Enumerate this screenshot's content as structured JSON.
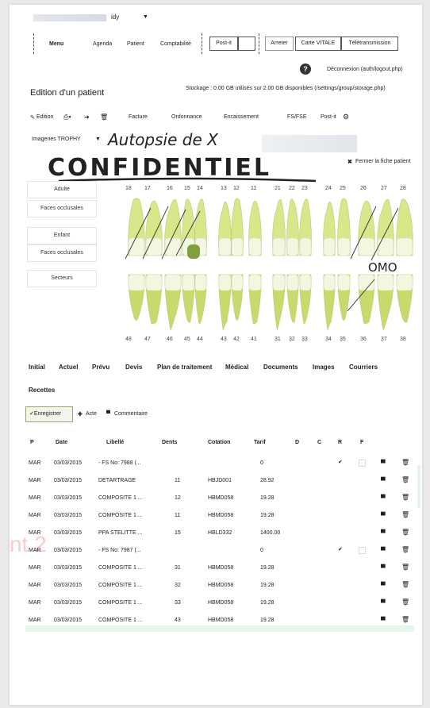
{
  "topbar": {
    "user_fragment": "idy",
    "caret": "▼"
  },
  "menu": {
    "items": [
      "Menu",
      "Agenda",
      "Patient",
      "Comptabilité"
    ],
    "postit_btn": "Post-it",
    "arreter_btn": "Arreter",
    "carte_vitale_btn": "Carte VITALE",
    "teletrans_btn": "Télétransmission"
  },
  "header": {
    "help_icon": "?",
    "logout": "Déconnexion (auth/logout.php)",
    "page_title": "Edition d'un patient",
    "storage": "Stockage : 0.00 GB utilisés sur 2.00 GB disponibles (/settings/group/storage.php)"
  },
  "toolbar": {
    "edition": "Edition",
    "facture": "Facture",
    "ordonnance": "Ordonnance",
    "encaissement": "Encaissement",
    "fsfse": "FS/FSE",
    "postit": "Post-it"
  },
  "imageries": {
    "select": "Imageries TROPHY",
    "caret": "▼"
  },
  "handwriting": {
    "line1": "Autopsie de X",
    "line2": "CONFIDENTIEL",
    "note": "OMO"
  },
  "fermer": "Fermer la fiche patient",
  "side": {
    "adulte": "Adulte",
    "faces1": "Faces occlusales",
    "enfant": "Enfant",
    "faces2": "Faces occlusales",
    "secteurs": "Secteurs"
  },
  "teeth": {
    "upper": [
      "18",
      "17",
      "16",
      "15",
      "14",
      "13",
      "12",
      "11",
      "21",
      "22",
      "23",
      "24",
      "25",
      "26",
      "27",
      "28"
    ],
    "lower": [
      "48",
      "47",
      "46",
      "45",
      "44",
      "43",
      "42",
      "41",
      "31",
      "32",
      "33",
      "34",
      "35",
      "36",
      "37",
      "38"
    ],
    "colors": {
      "tooth": "#d7e88b",
      "root": "#c7db6d",
      "crown": "#f2f7df",
      "filled": "#7ea13e"
    }
  },
  "tabs": [
    "Initial",
    "Actuel",
    "Prévu",
    "Devis",
    "Plan de traitement",
    "Médical",
    "Documents",
    "Images",
    "Courriers",
    "Recettes"
  ],
  "actions": {
    "save": "Enregistrer",
    "acte": "Acte",
    "commentaire": "Commentaire"
  },
  "table": {
    "headers": [
      "P",
      "Date",
      "Libellé",
      "Dents",
      "Cotation",
      "Tarif",
      "D",
      "C",
      "R",
      "F"
    ],
    "rows": [
      {
        "p": "MAR",
        "date": "03/03/2015",
        "lib": "- FS No: 7988 (...",
        "dents": "",
        "cot": "",
        "tarif": "0",
        "r": "✔"
      },
      {
        "p": "MAR",
        "date": "03/03/2015",
        "lib": "DETARTRAGE",
        "dents": "11",
        "cot": "HBJD001",
        "tarif": "28.92",
        "r": ""
      },
      {
        "p": "MAR",
        "date": "03/03/2015",
        "lib": "COMPOSITE 1 ...",
        "dents": "12",
        "cot": "HBMD058",
        "tarif": "19.28",
        "r": ""
      },
      {
        "p": "MAR",
        "date": "03/03/2015",
        "lib": "COMPOSITE 1 ...",
        "dents": "11",
        "cot": "HBMD058",
        "tarif": "19.28",
        "r": ""
      },
      {
        "p": "MAR",
        "date": "03/03/2015",
        "lib": "PPA STELITTE ...",
        "dents": "15",
        "cot": "HBLD332",
        "tarif": "1400.00",
        "r": ""
      },
      {
        "p": "MAR",
        "date": "03/03/2015",
        "lib": "- FS No: 7987 (...",
        "dents": "",
        "cot": "",
        "tarif": "0",
        "r": "✔"
      },
      {
        "p": "MAR",
        "date": "03/03/2015",
        "lib": "COMPOSITE 1 ...",
        "dents": "31",
        "cot": "HBMD058",
        "tarif": "19.28",
        "r": ""
      },
      {
        "p": "MAR",
        "date": "03/03/2015",
        "lib": "COMPOSITE 1 ...",
        "dents": "32",
        "cot": "HBMD058",
        "tarif": "19.28",
        "r": ""
      },
      {
        "p": "MAR",
        "date": "03/03/2015",
        "lib": "COMPOSITE 1 ...",
        "dents": "33",
        "cot": "HBMD058",
        "tarif": "19.28",
        "r": ""
      },
      {
        "p": "MAR",
        "date": "03/03/2015",
        "lib": "COMPOSITE 1 ...",
        "dents": "43",
        "cot": "HBMD058",
        "tarif": "19.28",
        "r": ""
      }
    ]
  },
  "watermark": "nt 2"
}
